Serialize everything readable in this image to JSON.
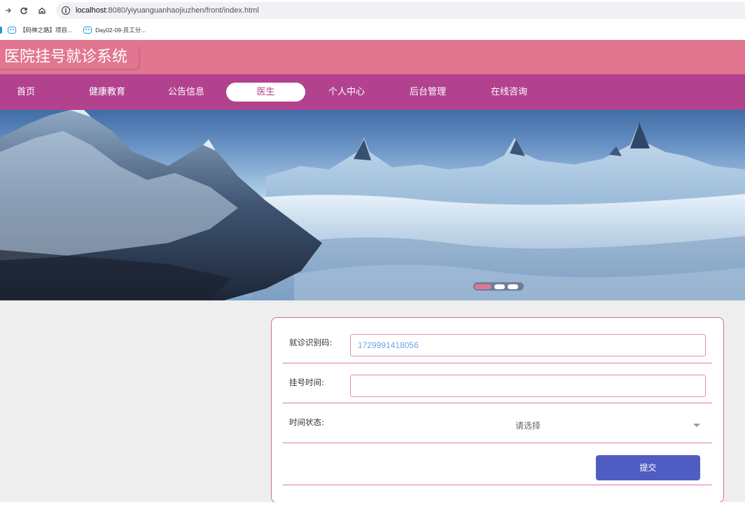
{
  "browser": {
    "url_host": "localhost",
    "url_path": ":8080/yiyuanguanhaojiuzhen/front/index.html",
    "bookmarks": [
      "【码神之路】项目...",
      "Day02-09-员工分..."
    ]
  },
  "site": {
    "title": "医院挂号就诊系统"
  },
  "nav": {
    "items": [
      "首页",
      "健康教育",
      "公告信息",
      "医生",
      "个人中心",
      "后台管理",
      "在线咨询"
    ],
    "active_index": 3
  },
  "colors": {
    "header": "#e27691",
    "navbar": "#b2428e",
    "submit": "#4f5dc3"
  },
  "banner": {
    "slides": 3,
    "active_slide": 1
  },
  "form": {
    "code_label": "就诊识别码:",
    "code_value": "1729991418056",
    "time_label": "挂号时间:",
    "time_value": "",
    "status_label": "时间状态:",
    "status_placeholder": "请选择",
    "submit_label": "提交"
  }
}
